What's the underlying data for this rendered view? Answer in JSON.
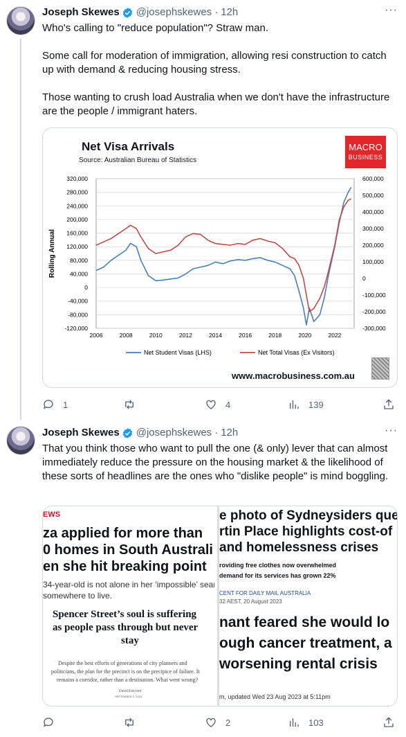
{
  "tweets": [
    {
      "author_name": "Joseph Skewes",
      "handle": "@josephskewes",
      "separator": "·",
      "time": "12h",
      "text": "Who's calling to \"reduce population\"? Straw man.\n\nSome call for moderation of immigration, allowing resi construction to catch up with demand & reducing housing stress.\n\nThose wanting to crush load Australia when we don't have the infrastructure are the people / immigrant haters.",
      "actions": {
        "replies": "1",
        "retweets": "",
        "likes": "4",
        "views": "139"
      }
    },
    {
      "author_name": "Joseph Skewes",
      "handle": "@josephskewes",
      "separator": "·",
      "time": "12h",
      "text": "That you think those who want to pull the one (& only) lever that can almost immediately reduce the pressure on the housing market & the likelihood of these sorts of headlines are the ones who \"dislike people\" is mind boggling.",
      "actions": {
        "replies": "",
        "retweets": "",
        "likes": "2",
        "views": "103"
      }
    }
  ],
  "chart_data": {
    "type": "line",
    "title": "Net Visa Arrivals",
    "subtitle": "Source: Australian Bureau of Statistics",
    "logo_line1": "MACRO",
    "logo_line2": "BUSINESS",
    "website": "www.macrobusiness.com.au",
    "ylabel": "Rolling Annual",
    "x_ticks": [
      "2006",
      "2008",
      "2010",
      "2012",
      "2014",
      "2016",
      "2018",
      "2020",
      "2022"
    ],
    "xlim": [
      2006,
      2023.3
    ],
    "ylim_left": [
      -120000,
      320000
    ],
    "ylim_right": [
      -300000,
      600000
    ],
    "y_ticks_left": [
      "320,000",
      "280,000",
      "240,000",
      "200,000",
      "160,000",
      "120,000",
      "80,000",
      "40,000",
      "0",
      "-40,000",
      "-80,000",
      "-120,000"
    ],
    "y_ticks_right": [
      "600,000",
      "500,000",
      "400,000",
      "300,000",
      "200,000",
      "100,000",
      "0",
      "-100,000",
      "-200,000",
      "-300,000"
    ],
    "grid": true,
    "legend_position": "bottom",
    "series": [
      {
        "name": "Net Student Visas (LHS)",
        "axis": "left",
        "color": "#4a7ebb",
        "x": [
          2006,
          2006.5,
          2007,
          2007.5,
          2008,
          2008.3,
          2008.7,
          2009,
          2009.5,
          2010,
          2010.5,
          2011,
          2011.5,
          2012,
          2012.5,
          2013,
          2013.5,
          2014,
          2014.5,
          2015,
          2015.5,
          2016,
          2016.5,
          2017,
          2017.5,
          2018,
          2018.5,
          2019,
          2019.3,
          2019.6,
          2019.9,
          2020.1,
          2020.3,
          2020.6,
          2021,
          2021.3,
          2021.6,
          2022,
          2022.3,
          2022.6,
          2022.9,
          2023.1
        ],
        "values": [
          50000,
          60000,
          80000,
          95000,
          110000,
          130000,
          120000,
          80000,
          35000,
          20000,
          22000,
          25000,
          28000,
          40000,
          55000,
          60000,
          65000,
          75000,
          70000,
          78000,
          82000,
          80000,
          85000,
          88000,
          80000,
          75000,
          65000,
          55000,
          35000,
          -10000,
          -60000,
          -110000,
          -60000,
          -100000,
          -80000,
          -30000,
          40000,
          120000,
          190000,
          250000,
          280000,
          295000
        ]
      },
      {
        "name": "Net Total Visas (Ex Visitors)",
        "axis": "right",
        "color": "#be4b48",
        "x": [
          2006,
          2006.5,
          2007,
          2007.5,
          2008,
          2008.3,
          2008.7,
          2009,
          2009.5,
          2010,
          2010.5,
          2011,
          2011.5,
          2012,
          2012.5,
          2013,
          2013.5,
          2014,
          2014.5,
          2015,
          2015.5,
          2016,
          2016.5,
          2017,
          2017.5,
          2018,
          2018.5,
          2019,
          2019.3,
          2019.6,
          2019.9,
          2020.1,
          2020.3,
          2020.6,
          2021,
          2021.3,
          2021.6,
          2022,
          2022.3,
          2022.6,
          2022.9,
          2023.1
        ],
        "values": [
          200000,
          220000,
          240000,
          270000,
          300000,
          320000,
          300000,
          250000,
          180000,
          150000,
          160000,
          170000,
          200000,
          250000,
          270000,
          265000,
          230000,
          210000,
          205000,
          200000,
          210000,
          205000,
          230000,
          240000,
          225000,
          215000,
          180000,
          130000,
          120000,
          80000,
          0,
          -100000,
          -200000,
          -180000,
          -120000,
          -50000,
          50000,
          200000,
          350000,
          430000,
          470000,
          480000
        ]
      }
    ]
  },
  "news_collage": {
    "left_top": "EWS",
    "left_headline_1": "za applied for more than",
    "left_headline_2": "0 homes in South Australi",
    "left_headline_3": "en she hit breaking point",
    "left_sub_1": "34-year-old is not alone in her ‘impossible’ search",
    "left_sub_2": "somewhere to live.",
    "left_serif_1": "Spencer Street’s soul is suffering",
    "left_serif_2": "as people pass through but never",
    "left_serif_3": "stay",
    "left_body_1": "Despite the best efforts of generations of city planners and",
    "left_body_2": "politicians, the plan for the precinct is on the precipice of failure. It",
    "left_body_3": "remains a corridor, rather than a destination. What went wrong?",
    "left_byline": "David Estcourt",
    "left_date": "SEPTEMBER 2, 2023",
    "right_headline_1": "e photo of Sydneysiders que",
    "right_headline_2": "rtin Place highlights cost-of",
    "right_headline_3": "and homelessness crises",
    "right_bullet_1": "roviding free clothes now overwhelmed",
    "right_bullet_2": "demand for its services has grown 22%",
    "right_meta_1": "CENT FOR DAILY MAIL AUSTRALIA",
    "right_meta_2": "32 AEST, 20 August 2023",
    "right_headline_4": "nant feared she would lo",
    "right_headline_5": "ough cancer treatment, a",
    "right_headline_6": "worsening rental crisis",
    "right_updated": "m, updated Wed 23 Aug 2023 at 5:11pm"
  }
}
